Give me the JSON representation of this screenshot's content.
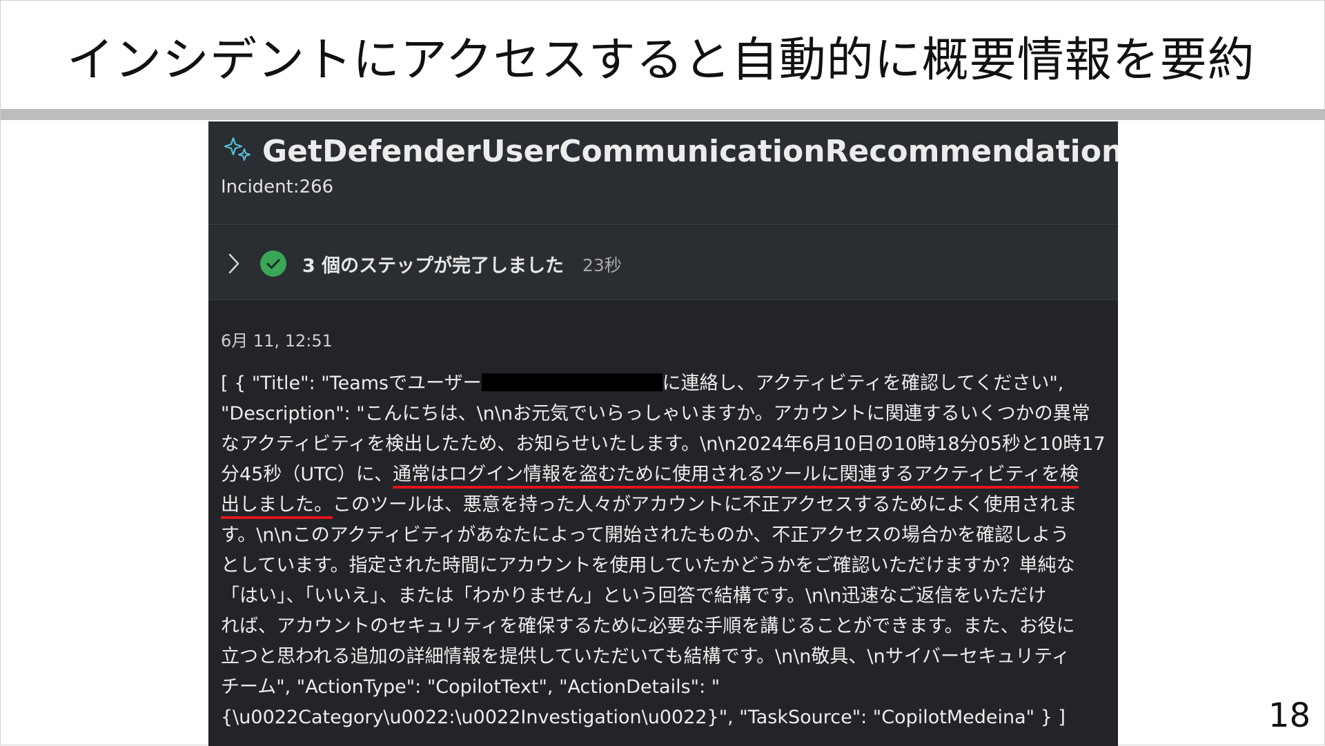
{
  "slide": {
    "title": "インシデントにアクセスすると自動的に概要情報を要約",
    "page_number": "18"
  },
  "panel": {
    "icon": "sparkle-icon",
    "title": "GetDefenderUserCommunicationRecommendation",
    "subtitle": "Incident:266",
    "steps": {
      "label": "3 個のステップが完了しました",
      "duration": "23秒",
      "status_color": "#3aa657"
    },
    "timestamp": "6月 11, 12:51",
    "body_lines": [
      {
        "a": "[ { \"Title\": \"Teamsでユーザー",
        "redacted": true,
        "b": "に連絡し、アクティビティを確認してください\","
      },
      {
        "text": "\"Description\": \"こんにちは、\\n\\nお元気でいらっしゃいますか。アカウントに関連するいくつかの異常"
      },
      {
        "text": "なアクティビティを検出したため、お知らせいたします。\\n\\n2024年6月10日の10時18分05秒と10時17"
      },
      {
        "a": "分45秒（UTC）に、",
        "ul": "通常はログイン情報を盗むために使用されるツールに関連するアクティビティを検"
      },
      {
        "ul": "出しました。",
        "b": "このツールは、悪意を持った人々がアカウントに不正アクセスするためによく使用されま"
      },
      {
        "text": "す。\\n\\nこのアクティビティがあなたによって開始されたものか、不正アクセスの場合かを確認しよう"
      },
      {
        "text": "としています。指定された時間にアカウントを使用していたかどうかをご確認いただけますか？単純な"
      },
      {
        "text": "「はい」、「いいえ」、または「わかりません」という回答で結構です。\\n\\n迅速なご返信をいただけ"
      },
      {
        "text": "れば、アカウントのセキュリティを確保するために必要な手順を講じることができます。また、お役に"
      },
      {
        "text": "立つと思われる追加の詳細情報を提供していただいても結構です。\\n\\n敬具、\\nサイバーセキュリティ"
      },
      {
        "text": "チーム\", \"ActionType\": \"CopilotText\", \"ActionDetails\": \""
      },
      {
        "text": "{\\u0022Category\\u0022:\\u0022Investigation\\u0022}\", \"TaskSource\": \"CopilotMedeina\" } ]"
      }
    ]
  },
  "colors": {
    "panel_bg": "#222428",
    "header_bg": "#2a2d31",
    "underline": "#e5141b",
    "rule": "#bdbdbd"
  }
}
